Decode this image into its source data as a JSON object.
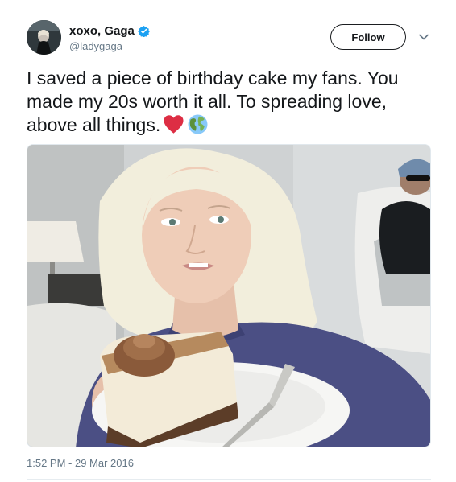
{
  "author": {
    "display_name": "xoxo, Gaga",
    "handle": "@ladygaga",
    "verified": true,
    "avatar_icon": "profile-photo"
  },
  "actions": {
    "follow_label": "Follow",
    "more_icon": "chevron-down-icon"
  },
  "tweet": {
    "text": "I saved a piece of birthday cake my fans. You made my 20s worth it all.  To spreading love, above all things.",
    "emojis": [
      "red-heart-icon",
      "globe-americas-icon"
    ]
  },
  "media": {
    "type": "photo",
    "icon": "selfie-with-cake-photo"
  },
  "meta": {
    "timestamp": "1:52 PM - 29 Mar 2016"
  },
  "colors": {
    "text": "#14171a",
    "secondary": "#657786",
    "verified_blue": "#1da1f2",
    "heart_red": "#dd2e44",
    "divider": "#e6ecf0"
  }
}
